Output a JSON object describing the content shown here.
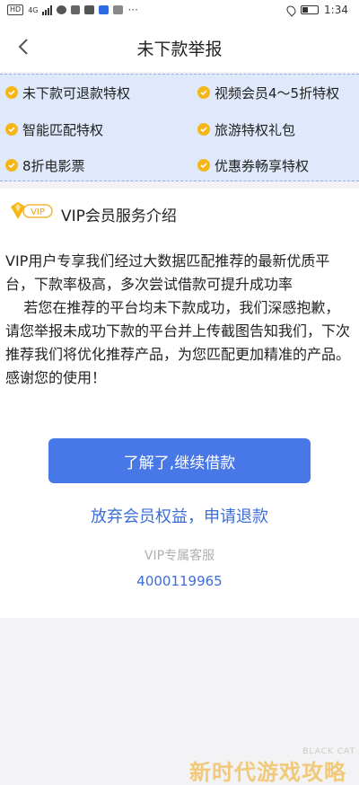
{
  "status_bar": {
    "badge_hd": "HD",
    "network": "4G",
    "time": "1:34"
  },
  "nav": {
    "title": "未下款举报"
  },
  "privileges": [
    {
      "label": "未下款可退款特权"
    },
    {
      "label": "视频会员4～5折特权"
    },
    {
      "label": "智能匹配特权"
    },
    {
      "label": "旅游特权礼包"
    },
    {
      "label": "8折电影票"
    },
    {
      "label": "优惠券畅享特权"
    }
  ],
  "card": {
    "badge_text": "VIP",
    "title": "VIP会员服务介绍",
    "body": "VIP用户专享我们经过大数据匹配推荐的最新优质平台，下款率极高，多次尝试借款可提升成功率\n    若您在推荐的平台均未下款成功，我们深感抱歉，请您举报未成功下款的平台并上传截图告知我们，下次推荐我们将优化推荐产品，为您匹配更加精准的产品。感谢您的使用！"
  },
  "actions": {
    "primary_label": "了解了,继续借款",
    "refund_label": "放弃会员权益，申请退款",
    "cs_label": "VIP专属客服",
    "cs_phone": "4000119965"
  },
  "watermark": {
    "main": "新时代游戏攻略",
    "sub": "BLACK CAT"
  },
  "colors": {
    "accent_blue": "#4878e8",
    "link_blue": "#3d6dd6",
    "privilege_bg": "#dfe9fb",
    "check_yellow": "#f5b617"
  }
}
